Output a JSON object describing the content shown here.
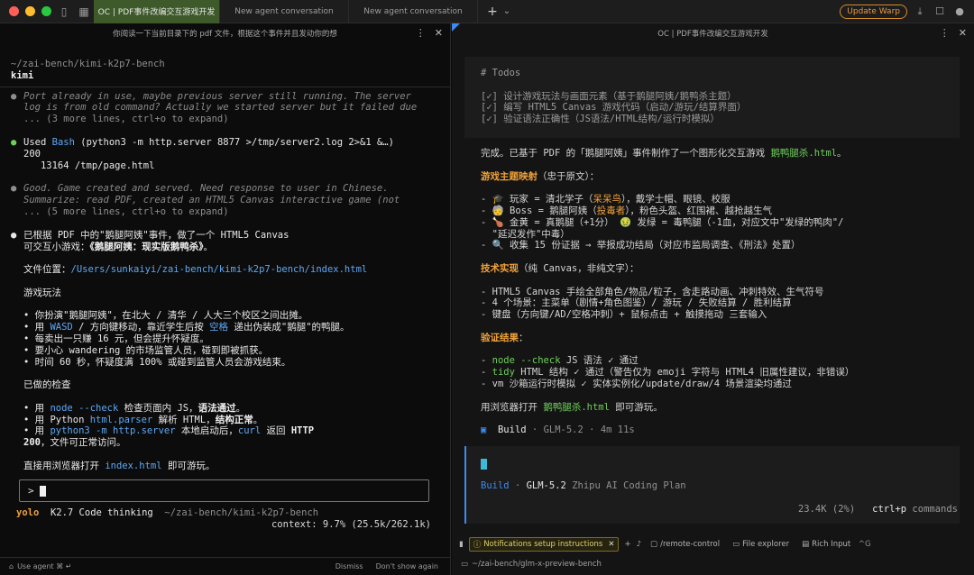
{
  "titlebar": {
    "tabs": [
      {
        "label": "OC | PDF事件改编交互游戏开发"
      },
      {
        "label": "New agent conversation"
      },
      {
        "label": "New agent conversation"
      }
    ],
    "new_tab": "+",
    "new_tab_menu": "⌄",
    "update_label": "Update Warp"
  },
  "left": {
    "header_title": "你阅读一下当前目录下的 pdf 文件，根据这个事件并且发动你的想",
    "cwd": "~/zai-bench/kimi-k2p7-bench",
    "agent_name": "kimi",
    "thought1": [
      "Port already in use, maybe previous server still running. The server",
      "log is from old command? Actually we started server but it failed due",
      "... (3 more lines, ctrl+o to expand)"
    ],
    "used_label": "Used",
    "used_tool": "Bash",
    "used_cmd": "(python3 -m http.server 8877 >/tmp/server2.log 2>&1 &…)",
    "used_out1": "200",
    "used_out2": "   13164 /tmp/page.html",
    "thought2": [
      "Good. Game created and served. Need response to user in Chinese.",
      "Summarize: read PDF, created an HTML5 Canvas interactive game (not",
      "... (5 more lines, ctrl+o to expand)"
    ],
    "summary1": "已根据 PDF 中的\"鹅腿阿姨\"事件，做了一个 HTML5 Canvas",
    "summary2_pre": "可交互小游戏：",
    "summary2_bold": "《鹅腿阿姨：现实版鹅鸭杀》",
    "summary2_post": "。",
    "file_label": "文件位置：",
    "file_path": "/Users/sunkaiyi/zai-bench/kimi-k2p7-bench/index.html",
    "gameplay_title": "游戏玩法",
    "gameplay": [
      {
        "pre": "• 你扮演\"鹅腿阿姨\"，在北大 / 清华 / 人大三个校区之间出摊。",
        "hl": "",
        "post": ""
      },
      {
        "pre": "• 用 ",
        "hl": "WASD",
        "post": " / 方向键移动，靠近学生后按 "
      },
      {
        "pre": "• 每卖出一只赚 16 元，但会提升怀疑度。",
        "hl": "",
        "post": ""
      },
      {
        "pre": "• 要小心 wandering 的市场监管人员，碰到即被抓获。",
        "hl": "",
        "post": ""
      },
      {
        "pre": "• 时间 60 秒，怀疑度满 100% 或碰到监管人员会游戏结束。",
        "hl": "",
        "post": ""
      }
    ],
    "gameplay2_space": "空格",
    "gameplay2_tail": " 递出伪装成\"鹅腿\"的鸭腿。",
    "checks_title": "已做的检查",
    "check1_pre": "• 用 ",
    "check1_cmd": "node --check",
    "check1_mid": " 检查页面内 JS，",
    "check1_bold": "语法通过",
    "check1_post": "。",
    "check2_pre": "• 用 Python ",
    "check2_cmd": "html.parser",
    "check2_mid": " 解析 HTML，",
    "check2_bold": "结构正常",
    "check2_post": "。",
    "check3_pre": "• 用 ",
    "check3_cmd": "python3 -m http.server",
    "check3_mid": " 本地启动后，",
    "check3_curl": "curl",
    "check3_post": " 返回 ",
    "check3_bold": "HTTP",
    "check3_line2_bold": "200",
    "check3_line2_post": "，文件可正常访问。",
    "open_pre": "直接用浏览器打开 ",
    "open_file": "index.html",
    "open_post": " 即可游玩。",
    "input_prompt": ">",
    "status_mode": "yolo",
    "status_model": "K2.7 Code thinking",
    "status_path": "~/zai-bench/kimi-k2p7-bench",
    "context": "context: 9.7% (25.5k/262.1k)",
    "footer_agent": "Use agent ⌘ ↵",
    "footer_dismiss": "Dismiss",
    "footer_dont_show": "Don't show again"
  },
  "right": {
    "header_title": "OC | PDF事件改编交互游戏开发",
    "todos_title": "# Todos",
    "todos": [
      "[✓] 设计游戏玩法与画面元素（基于鹅腿阿姨/鹅鸭杀主题）",
      "[✓] 编写 HTML5 Canvas 游戏代码（启动/游玩/结算界面）",
      "[✓] 验证语法正确性（JS语法/HTML结构/运行时模拟）"
    ],
    "done_pre": "完成。已基于 PDF 的「鹅腿阿姨」事件制作了一个图形化交互游戏 ",
    "done_file": "鹅鸭腿杀.html",
    "done_post": "。",
    "mapping_title": "游戏主题映射",
    "mapping_sub": "（忠于原文）：",
    "mapping": [
      {
        "pre": "- 🎓 玩家 = 清北学子（",
        "hl": "呆呆鸟",
        "post": "），戴学士帽、眼镜、校服"
      },
      {
        "pre": "- 🧓 Boss = 鹅腿阿姨（",
        "hl": "投毒者",
        "post": "），粉色头盔、红围裙、越抢越生气"
      },
      {
        "pre": "- 🍗 金黄 = 真鹅腿（+1分）  🤢 发绿 = 毒鸭腿（-1血，对应文中\"发绿的鸭肉\"/",
        "hl": "",
        "post": ""
      },
      {
        "pre": "  \"延迟发作\"中毒）",
        "hl": "",
        "post": ""
      },
      {
        "pre": "- 🔍 收集 15 份证据 → 举报成功结局（对应市监局调查、《刑法》处置）",
        "hl": "",
        "post": ""
      }
    ],
    "tech_title": "技术实现",
    "tech_sub": "（纯 Canvas，非纯文字）：",
    "tech": [
      "- HTML5 Canvas 手绘全部角色/物品/粒子，含走路动画、冲刺特效、生气符号",
      "- 4 个场景：主菜单（剧情+角色图鉴）/ 游玩 / 失败结算 / 胜利结算",
      "- 键盘（方向键/AD/空格冲刺）+ 鼠标点击 + 触摸拖动 三套输入"
    ],
    "verify_title": "验证结果",
    "verify_sub": "：",
    "verify": [
      {
        "pre": "- ",
        "cmd": "node --check",
        "post": " JS 语法 ✓ 通过"
      },
      {
        "pre": "- ",
        "cmd": "tidy",
        "post": " HTML 结构 ✓ 通过（警告仅为 emoji 字符与 HTML4 旧属性建议，非错误）"
      },
      {
        "pre": "- vm 沙箱运行时模拟 ✓ 实体实例化/update/draw/4 场景渲染均通过",
        "cmd": "",
        "post": ""
      }
    ],
    "open_pre": "用浏览器打开 ",
    "open_file": "鹅鸭腿杀.html",
    "open_post": " 即可游玩。",
    "build_label": "Build",
    "build_model": "GLM-5.2",
    "build_time": "4m 11s",
    "build_box_label": "Build",
    "build_box_model": "GLM-5.2",
    "build_box_provider": "Zhipu AI Coding Plan",
    "tokens": "23.4K (2%)",
    "ctrlp": "ctrl+p",
    "commands": "commands",
    "footer_notif": "Notifications setup instructions",
    "footer_remote": "/remote-control",
    "footer_explorer": "File explorer",
    "footer_rich": "Rich Input",
    "footer_rich_key": "^G",
    "footer_path": "~/zai-bench/glm-x-preview-bench"
  },
  "colors": {
    "accent_blue": "#3d8bf0",
    "active_tab": "#3e5a2a",
    "update_orange": "#e89a3c",
    "green": "#6fcf5c",
    "orange": "#f0a23a"
  }
}
